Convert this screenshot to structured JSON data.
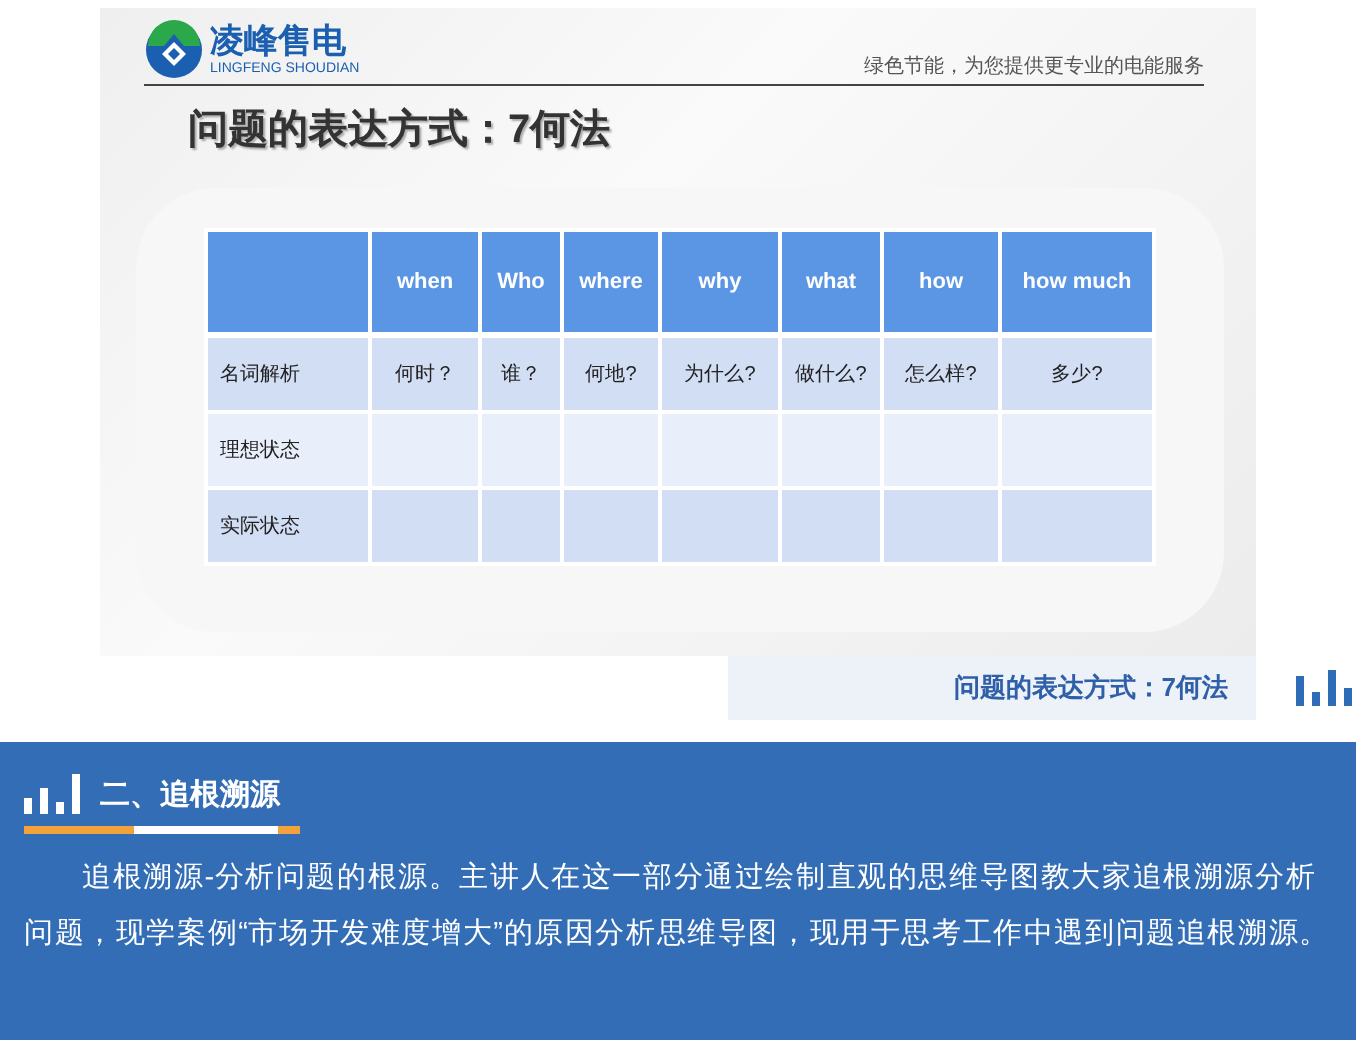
{
  "slide": {
    "logo": {
      "name": "凌峰售电",
      "subtitle": "LINGFENG SHOUDIAN"
    },
    "tagline": "绿色节能，为您提供更专业的电能服务",
    "title": "问题的表达方式：7何法",
    "table": {
      "columns": [
        "when",
        "Who",
        "where",
        "why",
        "what",
        "how",
        "how much"
      ],
      "rows": [
        {
          "label": "名词解析",
          "cells": [
            "何时？",
            "谁？",
            "何地?",
            "为什么?",
            "做什么?",
            "怎么样?",
            "多少?"
          ]
        },
        {
          "label": "理想状态"
        },
        {
          "label": "实际状态"
        }
      ]
    }
  },
  "caption": "问题的表达方式：7何法",
  "section": {
    "title": "二、追根溯源",
    "paragraph": "追根溯源-分析问题的根源。主讲人在这一部分通过绘制直观的思维导图教大家追根溯源分析问题，现学案例“市场开发难度增大”的原因分析思维导图，现用于思考工作中遇到问题追根溯源。"
  }
}
